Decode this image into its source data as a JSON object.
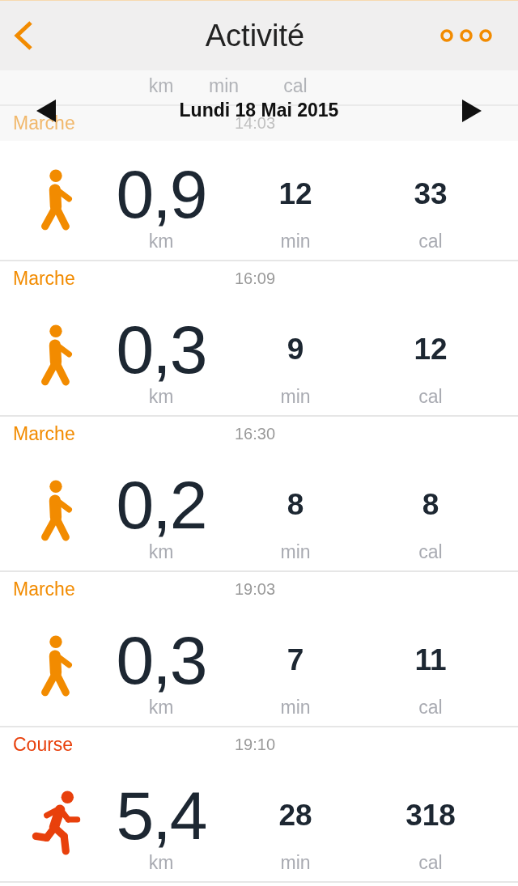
{
  "header": {
    "title": "Activité"
  },
  "date_bar": {
    "date": "Lundi 18 Mai 2015"
  },
  "scrolled_units": [
    "km",
    "min",
    "cal"
  ],
  "entries": [
    {
      "kind": "walk",
      "color": "#f28b00",
      "label": "Marche",
      "time": "14:03",
      "distance": "0,9",
      "distance_unit": "km",
      "duration": "12",
      "duration_unit": "min",
      "calories": "33",
      "calories_unit": "cal"
    },
    {
      "kind": "walk",
      "color": "#f28b00",
      "label": "Marche",
      "time": "16:09",
      "distance": "0,3",
      "distance_unit": "km",
      "duration": "9",
      "duration_unit": "min",
      "calories": "12",
      "calories_unit": "cal"
    },
    {
      "kind": "walk",
      "color": "#f28b00",
      "label": "Marche",
      "time": "16:30",
      "distance": "0,2",
      "distance_unit": "km",
      "duration": "8",
      "duration_unit": "min",
      "calories": "8",
      "calories_unit": "cal"
    },
    {
      "kind": "walk",
      "color": "#f28b00",
      "label": "Marche",
      "time": "19:03",
      "distance": "0,3",
      "distance_unit": "km",
      "duration": "7",
      "duration_unit": "min",
      "calories": "11",
      "calories_unit": "cal"
    },
    {
      "kind": "run",
      "color": "#e8400c",
      "label": "Course",
      "time": "19:10",
      "distance": "5,4",
      "distance_unit": "km",
      "duration": "28",
      "duration_unit": "min",
      "calories": "318",
      "calories_unit": "cal"
    }
  ]
}
